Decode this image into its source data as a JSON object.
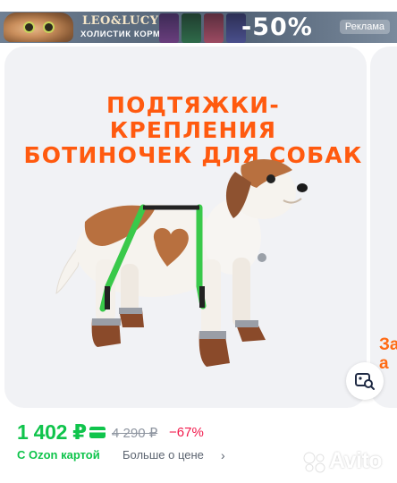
{
  "banner": {
    "brand": "LEO&LUCY",
    "subtitle": "ХОЛИСТИК КОРМ",
    "discount": "-50%",
    "ad_label": "Реклама"
  },
  "product": {
    "headline_line1": "ПОДТЯЖКИ-КРЕПЛЕНИЯ",
    "headline_line2": "БОТИНОЧЕК ДЛЯ СОБАК",
    "next_card_peek_line1": "За",
    "next_card_peek_line2": "а"
  },
  "price": {
    "current": "1 402 ₽",
    "old": "4 290 ₽",
    "discount": "−67%",
    "ozon_card": "С Ozon картой",
    "more_price": "Больше о цене",
    "chevron": "›"
  },
  "watermark": "Avito",
  "colors": {
    "accent_orange": "#ff5a0f",
    "price_green": "#10c44c",
    "discount_red": "#f2194b",
    "strap_green": "#39c94a"
  },
  "icons": {
    "zoom": "image-search-icon",
    "card": "ozon-card-icon"
  }
}
